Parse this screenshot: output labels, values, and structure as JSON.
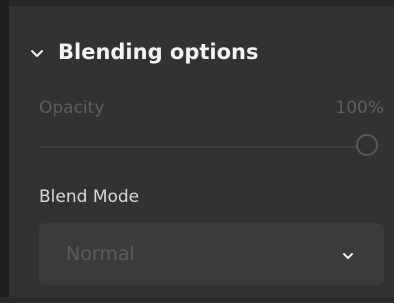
{
  "section": {
    "title": "Blending options",
    "expanded": true,
    "chevron_icon": "chevron-down-icon"
  },
  "opacity": {
    "label": "Opacity",
    "value_text": "100%",
    "value": 100
  },
  "blend_mode": {
    "label": "Blend Mode",
    "selected": "Normal",
    "chevron_icon": "chevron-down-icon"
  },
  "colors": {
    "panel_bg": "#323232",
    "header_text": "#f4f4f4",
    "muted_text": "#5e5e5e",
    "label_text": "#d8d8d8",
    "field_bg": "#3b3b3b"
  }
}
